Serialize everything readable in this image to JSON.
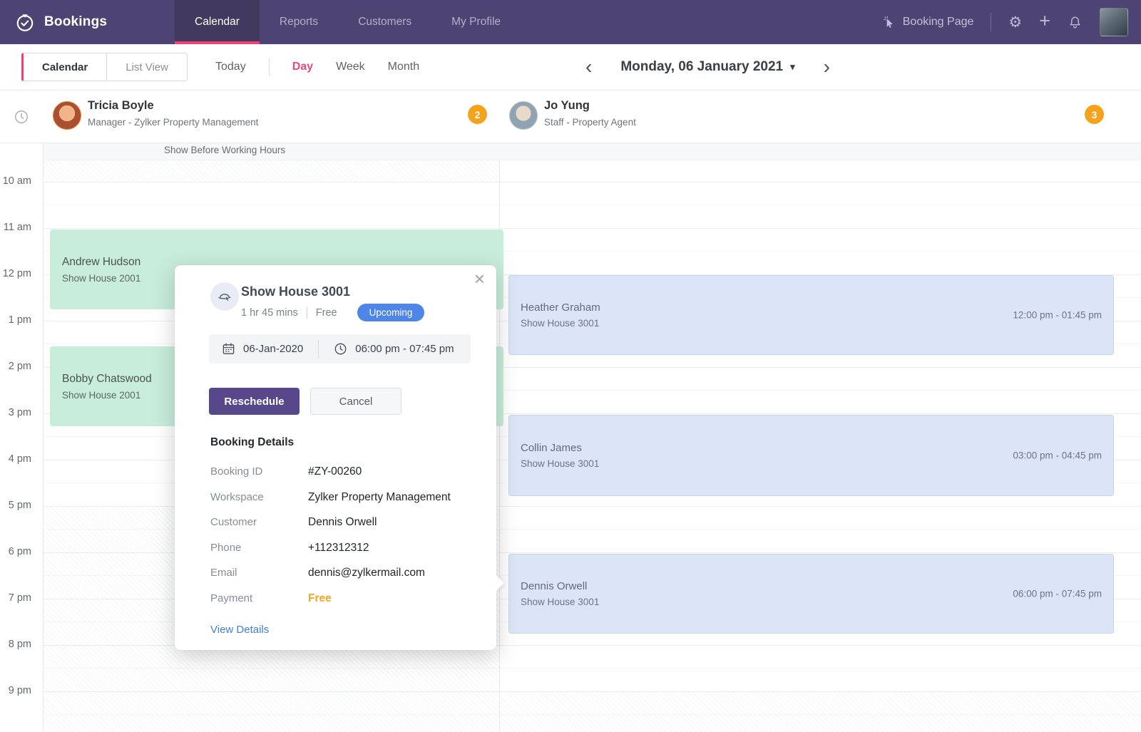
{
  "nav": {
    "brand": "Bookings",
    "tabs": [
      {
        "label": "Calendar"
      },
      {
        "label": "Reports"
      },
      {
        "label": "Customers"
      },
      {
        "label": "My Profile"
      }
    ],
    "booking_page": "Booking Page"
  },
  "icons": {
    "settings": "⚙",
    "add": "+",
    "close": "×",
    "chevron_left": "‹",
    "chevron_right": "›",
    "caret_down": "▾"
  },
  "toolbar": {
    "view_tabs": [
      {
        "label": "Calendar"
      },
      {
        "label": "List View"
      }
    ],
    "today": "Today",
    "ranges": [
      {
        "label": "Day"
      },
      {
        "label": "Week"
      },
      {
        "label": "Month"
      }
    ],
    "date": "Monday, 06 January 2021"
  },
  "staff": [
    {
      "name": "Tricia Boyle",
      "role": "Manager - Zylker Property Management",
      "badge": "2"
    },
    {
      "name": "Jo Yung",
      "role": "Staff - Property Agent",
      "badge": "3"
    }
  ],
  "grid": {
    "before_hours": "Show Before Working Hours",
    "times": [
      "10 am",
      "11 am",
      "12 pm",
      "1 pm",
      "2 pm",
      "3 pm",
      "4 pm",
      "5 pm",
      "6 pm",
      "7 pm",
      "8 pm",
      "9 pm"
    ],
    "events": {
      "tricia": [
        {
          "name": "Andrew Hudson",
          "service": "Show House 2001"
        },
        {
          "name": "Bobby Chatswood",
          "service": "Show House 2001"
        }
      ],
      "jo": [
        {
          "name": "Heather Graham",
          "service": "Show House 3001",
          "time": "12:00 pm - 01:45 pm"
        },
        {
          "name": "Collin James",
          "service": "Show House 3001",
          "time": "03:00 pm - 04:45 pm"
        },
        {
          "name": "Dennis Orwell",
          "service": "Show House 3001",
          "time": "06:00 pm - 07:45 pm"
        }
      ]
    }
  },
  "popup": {
    "title": "Show House 3001",
    "duration": "1 hr 45 mins",
    "price": "Free",
    "status": "Upcoming",
    "date": "06-Jan-2020",
    "time": "06:00 pm - 07:45 pm",
    "reschedule": "Reschedule",
    "cancel": "Cancel",
    "details_heading": "Booking Details",
    "details": [
      {
        "label": "Booking ID",
        "value": "#ZY-00260"
      },
      {
        "label": "Workspace",
        "value": "Zylker Property Management"
      },
      {
        "label": "Customer",
        "value": "Dennis Orwell"
      },
      {
        "label": "Phone",
        "value": "+112312312"
      },
      {
        "label": "Email",
        "value": "dennis@zylkermail.com"
      },
      {
        "label": "Payment",
        "value": "Free"
      }
    ],
    "view_details": "View Details"
  },
  "colors": {
    "nav_purple": "#4E4474",
    "accent_pink": "#F0417B",
    "badge_orange": "#F7A21B",
    "status_blue": "#4E86E8",
    "button_purple": "#56488A",
    "payment_orange": "#F5A623",
    "link_blue": "#3F80D8",
    "event_green": "#C8EDDA",
    "event_blue": "#DCE5F8"
  }
}
